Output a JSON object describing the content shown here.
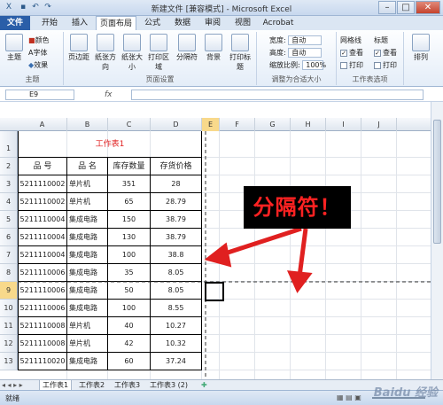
{
  "window": {
    "title": "新建文件  [兼容模式]  -  Microsoft Excel"
  },
  "tabs": [
    "文件",
    "开始",
    "插入",
    "页面布局",
    "公式",
    "数据",
    "审阅",
    "视图",
    "Acrobat"
  ],
  "ribbon": {
    "theme": {
      "main": "主题",
      "colors": "颜色",
      "fonts": "字体",
      "effects": "效果",
      "group": "主题"
    },
    "page_setup": {
      "margins": "页边距",
      "orientation": "纸张方向",
      "size": "纸张大小",
      "print_area": "打印区域",
      "breaks": "分隔符",
      "background": "背景",
      "print_titles": "打印标题",
      "group": "页面设置"
    },
    "scale": {
      "width_label": "宽度:",
      "width_value": "自动",
      "height_label": "高度:",
      "height_value": "自动",
      "scale_label": "缩放比例:",
      "scale_value": "100%",
      "group": "调整为合适大小"
    },
    "sheet_options": {
      "gridlines": "网格线",
      "headings": "标题",
      "view": "查看",
      "print": "打印",
      "group": "工作表选项"
    },
    "arrange": {
      "label": "排列"
    }
  },
  "formula_bar": {
    "name_box": "E9",
    "fx": "fx"
  },
  "columns": [
    "A",
    "B",
    "C",
    "D",
    "E",
    "F",
    "G",
    "H",
    "I",
    "J"
  ],
  "rows": [
    "1",
    "2",
    "3",
    "4",
    "5",
    "6",
    "7",
    "8",
    "9",
    "10",
    "11",
    "12",
    "13"
  ],
  "sheet": {
    "title": "工作表1",
    "headers": [
      "品  号",
      "品  名",
      "库存数量",
      "存货价格"
    ],
    "data": [
      [
        "5211110002",
        "单片机",
        "351",
        "28"
      ],
      [
        "5211110002",
        "单片机",
        "65",
        "28.79"
      ],
      [
        "5211110004",
        "集成电路",
        "150",
        "38.79"
      ],
      [
        "5211110004",
        "集成电路",
        "130",
        "38.79"
      ],
      [
        "5211110004",
        "集成电路",
        "100",
        "38.8"
      ],
      [
        "5211110006",
        "集成电路",
        "35",
        "8.05"
      ],
      [
        "5211110006",
        "集成电路",
        "50",
        "8.05"
      ],
      [
        "5211110006",
        "集成电路",
        "100",
        "8.55"
      ],
      [
        "5211110008",
        "单片机",
        "40",
        "10.27"
      ],
      [
        "5211110008",
        "单片机",
        "42",
        "10.32"
      ],
      [
        "5211110020",
        "集成电路",
        "60",
        "37.24"
      ]
    ]
  },
  "sheet_tabs": [
    "工作表1",
    "工作表2",
    "工作表3",
    "工作表3 (2)"
  ],
  "status": {
    "ready": "就绪"
  },
  "annotation": {
    "text": "分隔符！"
  },
  "watermark": "Baidu 经验",
  "colors": {
    "file_tab": "#2a5ea8",
    "title_red": "#e02020",
    "annotation_bg": "#000000",
    "annotation_text": "#ff2222"
  }
}
